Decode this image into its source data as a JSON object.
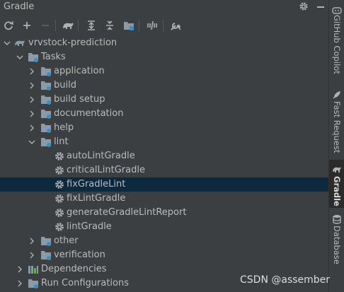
{
  "panel": {
    "title": "Gradle"
  },
  "tree": {
    "project": "vrvstock-prediction",
    "tasks_label": "Tasks",
    "groups": {
      "application": "application",
      "build": "build",
      "build_setup": "build setup",
      "documentation": "documentation",
      "help": "help",
      "lint": "lint",
      "other": "other",
      "verification": "verification"
    },
    "lint_tasks": [
      "autoLintGradle",
      "criticalLintGradle",
      "fixGradleLint",
      "fixLintGradle",
      "generateGradleLintReport",
      "lintGradle"
    ],
    "dependencies": "Dependencies",
    "run_configurations": "Run Configurations"
  },
  "sidebar": {
    "tabs": [
      "GitHub Copilot",
      "Fast Request",
      "Gradle",
      "Database"
    ]
  },
  "watermark": "CSDN @assember",
  "colors": {
    "selection": "#0d293e",
    "folder": "#8c9aa7",
    "gear": "#afb1b3",
    "accent_blue": "#3592c4"
  }
}
